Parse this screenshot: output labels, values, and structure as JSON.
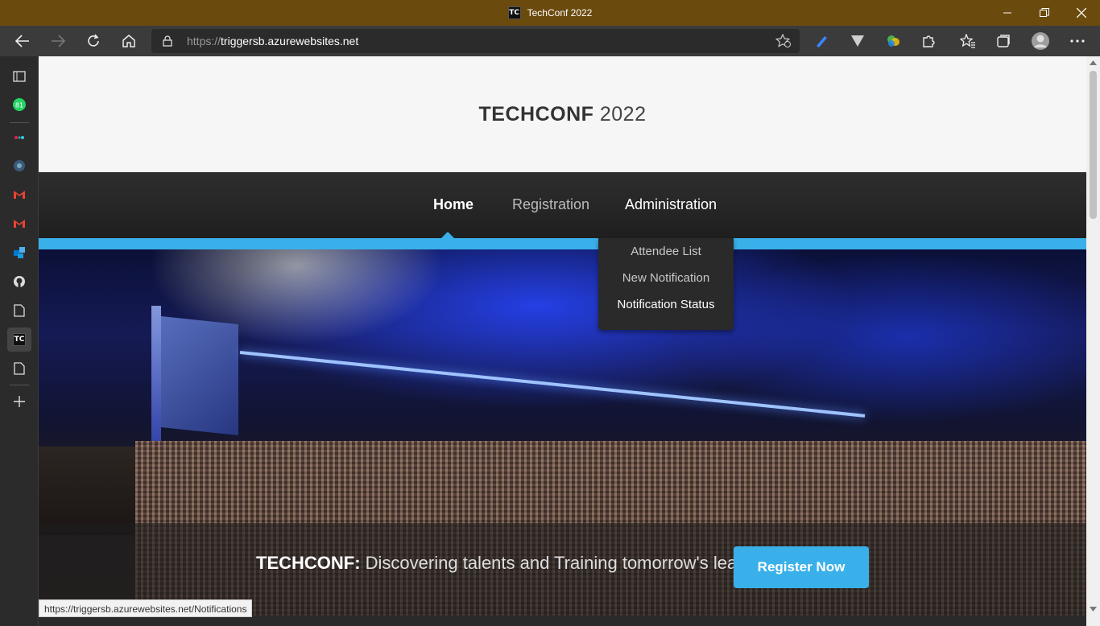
{
  "window": {
    "title": "TechConf 2022",
    "favicon_text": "TC"
  },
  "browser": {
    "url_prefix": "https://",
    "url_domain": "triggersb.azurewebsites.net",
    "status_url": "https://triggersb.azurewebsites.net/Notifications"
  },
  "sidebar": {
    "badge_count": "81",
    "active_tab_text": "TC"
  },
  "site": {
    "logo_strong": "TECHCONF",
    "logo_year": " 2022",
    "nav": {
      "home": "Home",
      "registration": "Registration",
      "administration": "Administration"
    },
    "dropdown": [
      "Attendee List",
      "New Notification",
      "Notification Status"
    ],
    "tagline_brand": "TECHCONF:",
    "tagline_text": " Discovering talents and Training tomorrow's leaders",
    "register_button": "Register Now"
  },
  "colors": {
    "titlebar": "#6b4a0e",
    "accent": "#3ab0ea",
    "navbar": "#262626"
  }
}
